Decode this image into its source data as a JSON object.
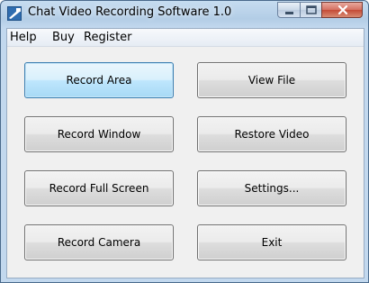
{
  "window": {
    "title": "Chat Video Recording Software 1.0",
    "icons": {
      "app": "app-icon",
      "minimize": "minimize-icon",
      "maximize": "maximize-icon",
      "close": "close-icon"
    }
  },
  "menu": {
    "items": [
      {
        "label": "Help"
      },
      {
        "label": "Buy"
      },
      {
        "label": "Register"
      }
    ]
  },
  "buttons": {
    "record_area": "Record Area",
    "view_file": "View File",
    "record_window": "Record Window",
    "restore_video": "Restore Video",
    "record_full_screen": "Record Full Screen",
    "settings": "Settings...",
    "record_camera": "Record Camera",
    "exit": "Exit"
  },
  "colors": {
    "titlebar": "#b3cde6",
    "close_button": "#c44a36",
    "focused_button_border": "#3c7fb1"
  }
}
